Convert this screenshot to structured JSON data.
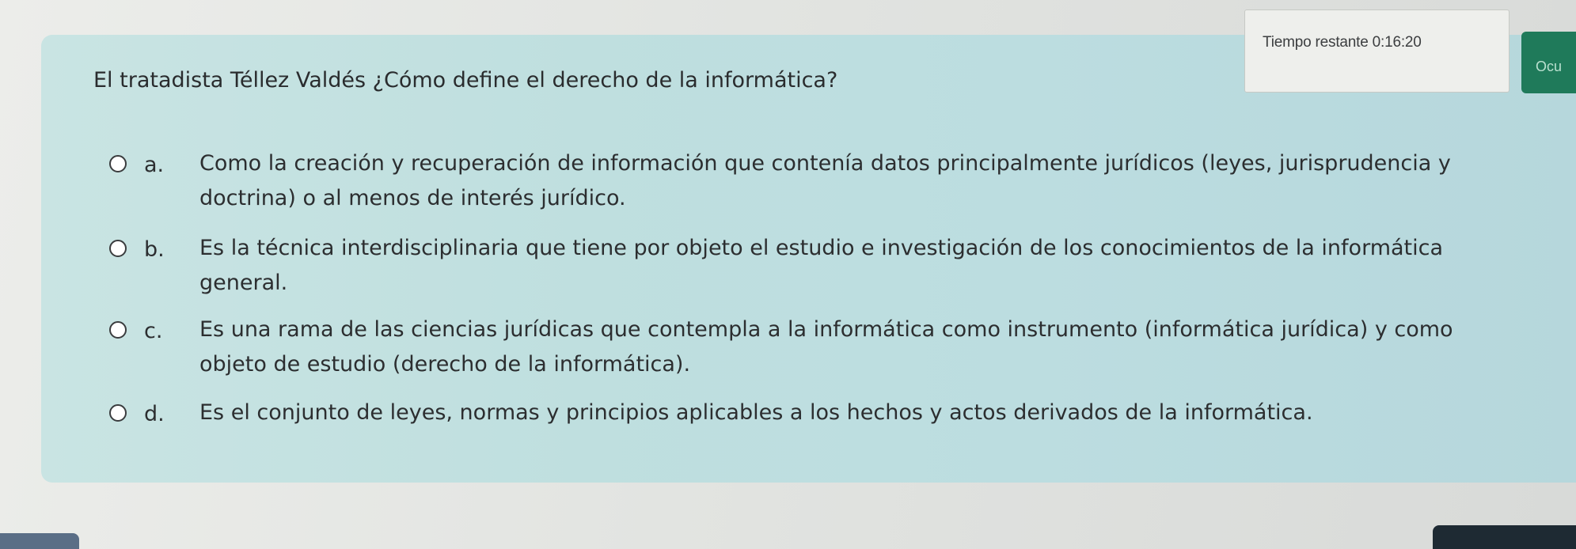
{
  "timer": {
    "text": "Tiempo restante 0:16:20"
  },
  "side_button": {
    "label": "Ocu"
  },
  "question": {
    "text": "El tratadista Téllez Valdés ¿Cómo define el derecho de la informática?"
  },
  "options": [
    {
      "letter": "a.",
      "line1": "Como la creación y recuperación de información que contenía datos principalmente jurídicos (leyes, jurisprudencia y",
      "line2": "doctrina) o al menos de interés jurídico."
    },
    {
      "letter": "b.",
      "line1": "Es la técnica interdisciplinaria que tiene por objeto el estudio e investigación de los conocimientos de la informática",
      "line2": "general."
    },
    {
      "letter": "c.",
      "line1": "Es una rama de las ciencias jurídicas que contempla a la informática como instrumento (informática jurídica) y como",
      "line2": "objeto de estudio (derecho de la informática)."
    },
    {
      "letter": "d.",
      "line1": "Es el conjunto de leyes, normas y principios aplicables a los hechos y actos derivados de la informática.",
      "line2": ""
    }
  ],
  "colors": {
    "panel": "#c1e0e1",
    "side_button": "#1f7a5a",
    "timer_bg": "#eeefec"
  }
}
